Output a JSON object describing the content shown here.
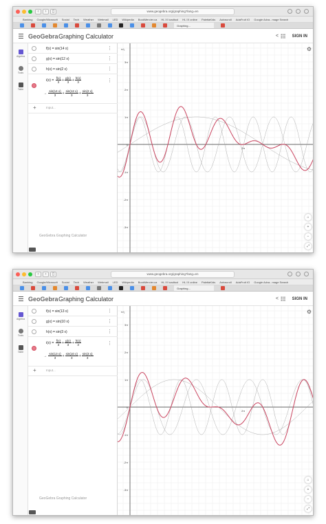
{
  "shots": [
    {
      "url": "www.geogebra.org/graphing?lang=en",
      "tab_title": "Graphing...",
      "bookmarks": [
        "Banking",
        "Google/Microsoft",
        "Social",
        "Tech",
        "Weather",
        "Webmail",
        "LED",
        "Wikipedia",
        "BookMercier.ca",
        "HL IX loadtool",
        "HL IX online",
        "PalettaKids",
        "Autoscroll",
        "AdaFruit IO",
        "Google Adva...mage Search"
      ],
      "app": {
        "logo": "GeoGebra",
        "title": "Graphing Calculator",
        "sign_in": "SIGN IN"
      },
      "sidebar": [
        {
          "label": "Algebra"
        },
        {
          "label": "Tools"
        },
        {
          "label": "Table"
        }
      ],
      "functions": [
        {
          "name": "f(x)",
          "expr": "f(x) = sin(14 x)"
        },
        {
          "name": "g(x)",
          "expr": "g(x) = sin(12 x)"
        },
        {
          "name": "h(x)",
          "expr": "h(x) = sin(2 x)"
        }
      ],
      "combo": {
        "lhs": "i(x) =",
        "f1n": "f(x)",
        "f1d": "3",
        "f2n": "g(x)",
        "f2d": "3",
        "f3n": "h(x)",
        "f3d": "3",
        "arrow": "→",
        "s1n": "sin(14 x)",
        "s1d": "3",
        "s2n": "sin(12 x)",
        "s2d": "3",
        "s3n": "sin(2 x)",
        "s3d": "3"
      },
      "input_placeholder": "Input...",
      "footer": "GeoGebra Graphing Calculator",
      "freqs": [
        14,
        12,
        2
      ],
      "y_ticks": [
        "3π",
        "2π",
        "1π",
        "0",
        "-1π",
        "-2π",
        "-3π"
      ],
      "y_axis_label": "π/₂",
      "x_tick_label": "2π"
    },
    {
      "url": "www.geogebra.org/graphing?lang=en",
      "tab_title": "Graphing...",
      "bookmarks": [
        "Banking",
        "Google/Microsoft",
        "Social",
        "Tech",
        "Weather",
        "Webmail",
        "LED",
        "Wikipedia",
        "BookMercier.ca",
        "HL IX loadtool",
        "HL IX online",
        "PalettaKids",
        "Autoscroll",
        "AdaFruit IO",
        "Google Adva...mage Search"
      ],
      "app": {
        "logo": "GeoGebra",
        "title": "Graphing Calculator",
        "sign_in": "SIGN IN"
      },
      "sidebar": [
        {
          "label": "Algebra"
        },
        {
          "label": "Tools"
        },
        {
          "label": "Table"
        }
      ],
      "functions": [
        {
          "name": "f(x)",
          "expr": "f(x) = sin(13 x)"
        },
        {
          "name": "g(x)",
          "expr": "g(x) = sin(10 x)"
        },
        {
          "name": "h(x)",
          "expr": "h(x) = sin(3 x)"
        }
      ],
      "combo": {
        "lhs": "i(x) =",
        "f1n": "f(x)",
        "f1d": "3",
        "f2n": "g(x)",
        "f2d": "3",
        "f3n": "h(x)",
        "f3d": "3",
        "arrow": "→",
        "s1n": "sin(13 x)",
        "s1d": "3",
        "s2n": "sin(10 x)",
        "s2d": "3",
        "s3n": "sin(3 x)",
        "s3d": "3"
      },
      "input_placeholder": "Input...",
      "footer": "GeoGebra Graphing Calculator",
      "freqs": [
        13,
        10,
        3
      ],
      "y_ticks": [
        "3π",
        "2π",
        "1π",
        "0",
        "-1π",
        "-2π",
        "-3π"
      ],
      "y_axis_label": "π/₂",
      "x_tick_label": "2π"
    }
  ],
  "colors": {
    "accent": "#c9435e",
    "curve_gray": "#9a9a9a",
    "grid": "#ececec",
    "axis": "#333333"
  }
}
